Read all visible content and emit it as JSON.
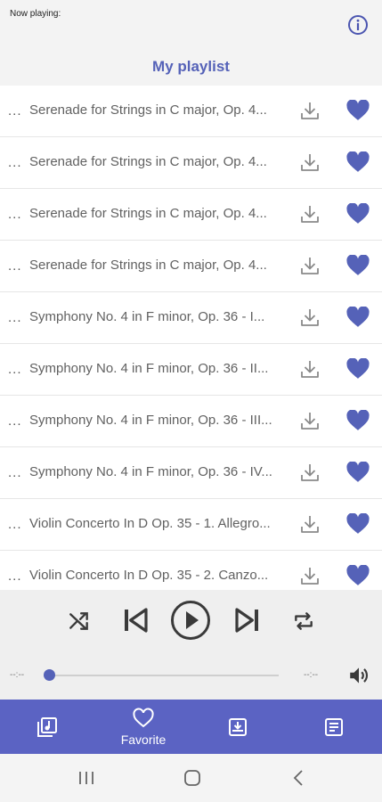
{
  "header": {
    "now_playing_label": "Now playing:",
    "title": "My playlist",
    "info_icon": "info-icon"
  },
  "playlist": [
    {
      "prefix": "...",
      "title": "Serenade for Strings in C major, Op. 4..."
    },
    {
      "prefix": "...",
      "title": "Serenade for Strings in C major, Op. 4..."
    },
    {
      "prefix": "...",
      "title": "Serenade for Strings in C major, Op. 4..."
    },
    {
      "prefix": "...",
      "title": "Serenade for Strings in C major, Op. 4..."
    },
    {
      "prefix": "...",
      "title": "Symphony No. 4 in F minor, Op. 36 - I..."
    },
    {
      "prefix": "...",
      "title": "Symphony No. 4 in F minor, Op. 36 - II..."
    },
    {
      "prefix": "...",
      "title": "Symphony No. 4 in F minor, Op. 36 - III..."
    },
    {
      "prefix": "...",
      "title": "Symphony No. 4 in F minor, Op. 36 - IV..."
    },
    {
      "prefix": "...",
      "title": "Violin Concerto In D Op. 35 - 1. Allegro..."
    },
    {
      "prefix": "...",
      "title": "Violin Concerto In D Op. 35 - 2. Canzo..."
    }
  ],
  "player": {
    "current_time": "--:--",
    "total_time": "--:--",
    "progress": 0
  },
  "bottom_nav": {
    "favorite_label": "Favorite"
  },
  "colors": {
    "accent": "#5b63c3",
    "heart": "#5562b8",
    "text": "#616161"
  }
}
